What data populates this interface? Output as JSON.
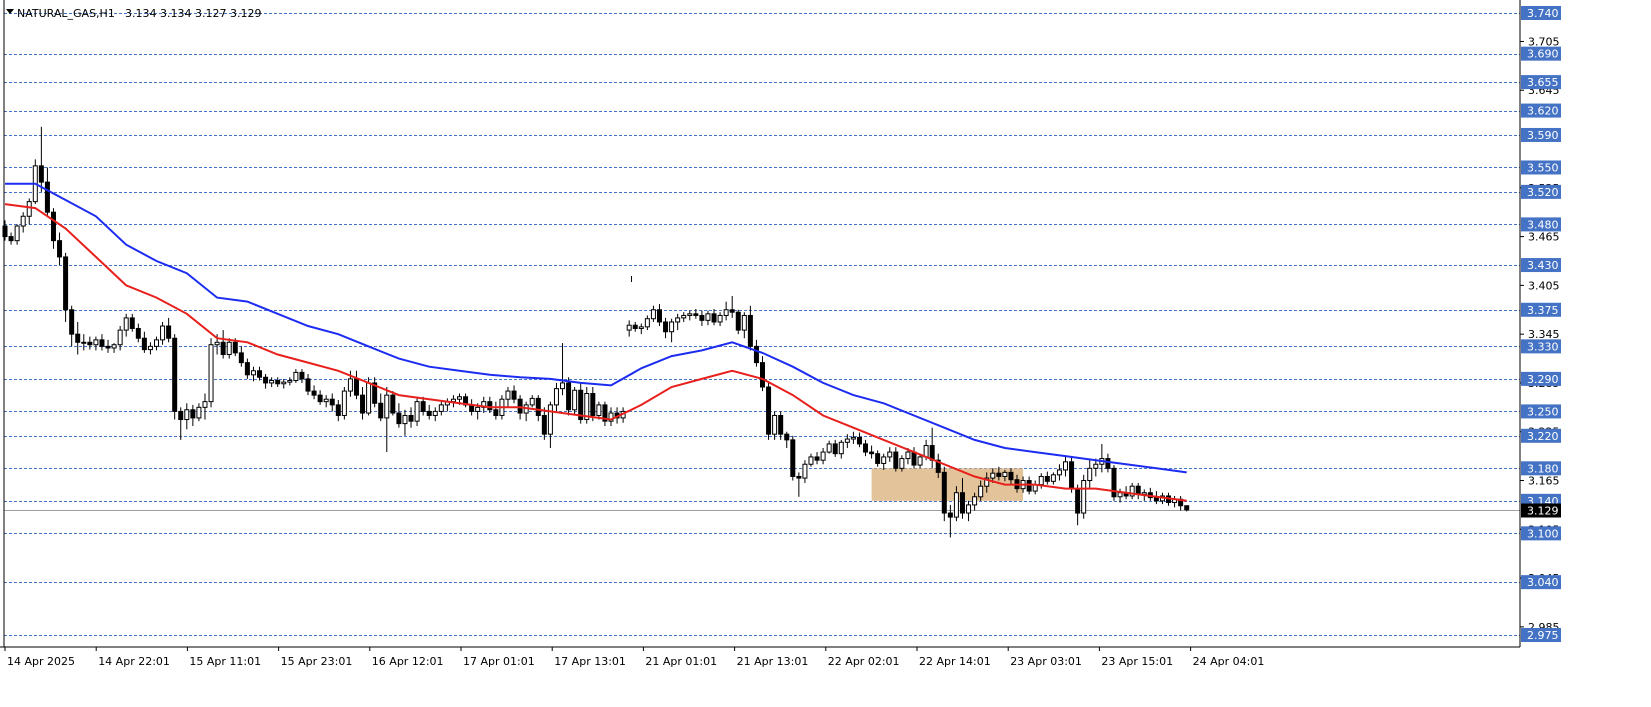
{
  "header": {
    "symbol": "NATURAL_GAS,H1",
    "ohlc": "3.134 3.134 3.127 3.129"
  },
  "colors": {
    "level_line": "#4472c4",
    "level_tag": "#4472c4",
    "ema_fast": "#e8201c",
    "ema_slow": "#1c2cf0",
    "zone": "#deb887",
    "price_tag": "#000000"
  },
  "chart_data": {
    "type": "candlestick",
    "ylim": [
      2.965,
      3.745
    ],
    "y_ticks": [
      "3.705",
      "3.645",
      "3.525",
      "3.465",
      "3.405",
      "3.345",
      "3.285",
      "3.225",
      "3.165",
      "3.105",
      "3.045",
      "2.985"
    ],
    "x_labels": [
      "14 Apr 2025",
      "14 Apr 22:01",
      "15 Apr 11:01",
      "15 Apr 23:01",
      "16 Apr 12:01",
      "17 Apr 01:01",
      "17 Apr 13:01",
      "21 Apr 01:01",
      "21 Apr 13:01",
      "22 Apr 02:01",
      "22 Apr 14:01",
      "23 Apr 03:01",
      "23 Apr 15:01",
      "24 Apr 04:01"
    ],
    "levels": [
      "3.740",
      "3.690",
      "3.655",
      "3.620",
      "3.590",
      "3.550",
      "3.520",
      "3.480",
      "3.430",
      "3.375",
      "3.330",
      "3.290",
      "3.250",
      "3.220",
      "3.180",
      "3.140",
      "3.100",
      "3.040",
      "2.975"
    ],
    "current_price": "3.129",
    "zone": {
      "bar_from": 143,
      "bar_to": 168,
      "price_top": 3.18,
      "price_bottom": 3.14
    },
    "ema_fast": [
      [
        0,
        3.505
      ],
      [
        5,
        3.5
      ],
      [
        10,
        3.475
      ],
      [
        15,
        3.44
      ],
      [
        20,
        3.405
      ],
      [
        25,
        3.39
      ],
      [
        30,
        3.37
      ],
      [
        35,
        3.34
      ],
      [
        40,
        3.335
      ],
      [
        45,
        3.32
      ],
      [
        50,
        3.31
      ],
      [
        55,
        3.3
      ],
      [
        60,
        3.285
      ],
      [
        65,
        3.27
      ],
      [
        70,
        3.265
      ],
      [
        75,
        3.26
      ],
      [
        80,
        3.255
      ],
      [
        85,
        3.255
      ],
      [
        90,
        3.25
      ],
      [
        95,
        3.245
      ],
      [
        100,
        3.24
      ],
      [
        105,
        3.258
      ],
      [
        110,
        3.28
      ],
      [
        115,
        3.29
      ],
      [
        120,
        3.3
      ],
      [
        125,
        3.29
      ],
      [
        130,
        3.27
      ],
      [
        135,
        3.245
      ],
      [
        140,
        3.23
      ],
      [
        145,
        3.215
      ],
      [
        150,
        3.2
      ],
      [
        155,
        3.185
      ],
      [
        160,
        3.17
      ],
      [
        165,
        3.16
      ],
      [
        170,
        3.16
      ],
      [
        175,
        3.155
      ],
      [
        180,
        3.155
      ],
      [
        185,
        3.15
      ],
      [
        190,
        3.145
      ],
      [
        195,
        3.14
      ]
    ],
    "ema_slow": [
      [
        0,
        3.53
      ],
      [
        5,
        3.53
      ],
      [
        10,
        3.51
      ],
      [
        15,
        3.49
      ],
      [
        20,
        3.455
      ],
      [
        25,
        3.435
      ],
      [
        30,
        3.42
      ],
      [
        35,
        3.39
      ],
      [
        40,
        3.385
      ],
      [
        45,
        3.37
      ],
      [
        50,
        3.355
      ],
      [
        55,
        3.345
      ],
      [
        60,
        3.33
      ],
      [
        65,
        3.315
      ],
      [
        70,
        3.305
      ],
      [
        75,
        3.3
      ],
      [
        80,
        3.295
      ],
      [
        85,
        3.292
      ],
      [
        90,
        3.29
      ],
      [
        95,
        3.285
      ],
      [
        100,
        3.282
      ],
      [
        105,
        3.303
      ],
      [
        110,
        3.318
      ],
      [
        115,
        3.325
      ],
      [
        120,
        3.335
      ],
      [
        125,
        3.322
      ],
      [
        130,
        3.305
      ],
      [
        135,
        3.285
      ],
      [
        140,
        3.27
      ],
      [
        145,
        3.26
      ],
      [
        150,
        3.245
      ],
      [
        155,
        3.23
      ],
      [
        160,
        3.215
      ],
      [
        165,
        3.205
      ],
      [
        170,
        3.2
      ],
      [
        175,
        3.195
      ],
      [
        180,
        3.19
      ],
      [
        185,
        3.185
      ],
      [
        190,
        3.18
      ],
      [
        195,
        3.175
      ]
    ],
    "candles": [
      [
        3.478,
        3.485,
        3.46,
        3.465
      ],
      [
        3.465,
        3.47,
        3.455,
        3.46
      ],
      [
        3.46,
        3.48,
        3.455,
        3.478
      ],
      [
        3.478,
        3.495,
        3.47,
        3.49
      ],
      [
        3.49,
        3.512,
        3.48,
        3.508
      ],
      [
        3.508,
        3.56,
        3.505,
        3.552
      ],
      [
        3.552,
        3.6,
        3.52,
        3.532
      ],
      [
        3.532,
        3.55,
        3.49,
        3.495
      ],
      [
        3.495,
        3.5,
        3.45,
        3.46
      ],
      [
        3.46,
        3.47,
        3.43,
        3.44
      ],
      [
        3.44,
        3.445,
        3.36,
        3.375
      ],
      [
        3.375,
        3.38,
        3.33,
        3.345
      ],
      [
        3.345,
        3.36,
        3.32,
        3.335
      ],
      [
        3.335,
        3.345,
        3.325,
        3.335
      ],
      [
        3.335,
        3.342,
        3.326,
        3.332
      ],
      [
        3.332,
        3.342,
        3.325,
        3.338
      ],
      [
        3.338,
        3.345,
        3.325,
        3.33
      ],
      [
        3.33,
        3.338,
        3.322,
        3.328
      ],
      [
        3.328,
        3.334,
        3.322,
        3.332
      ],
      [
        3.332,
        3.355,
        3.325,
        3.35
      ],
      [
        3.35,
        3.37,
        3.342,
        3.365
      ],
      [
        3.365,
        3.37,
        3.348,
        3.352
      ],
      [
        3.352,
        3.358,
        3.335,
        3.34
      ],
      [
        3.34,
        3.348,
        3.322,
        3.326
      ],
      [
        3.326,
        3.335,
        3.32,
        3.33
      ],
      [
        3.33,
        3.342,
        3.325,
        3.338
      ],
      [
        3.338,
        3.36,
        3.332,
        3.355
      ],
      [
        3.355,
        3.365,
        3.335,
        3.34
      ],
      [
        3.34,
        3.345,
        3.24,
        3.25
      ],
      [
        3.25,
        3.255,
        3.215,
        3.24
      ],
      [
        3.24,
        3.26,
        3.228,
        3.252
      ],
      [
        3.252,
        3.258,
        3.232,
        3.242
      ],
      [
        3.242,
        3.26,
        3.238,
        3.255
      ],
      [
        3.255,
        3.272,
        3.24,
        3.262
      ],
      [
        3.262,
        3.34,
        3.255,
        3.332
      ],
      [
        3.332,
        3.345,
        3.32,
        3.335
      ],
      [
        3.335,
        3.35,
        3.315,
        3.32
      ],
      [
        3.32,
        3.34,
        3.315,
        3.335
      ],
      [
        3.335,
        3.34,
        3.318,
        3.322
      ],
      [
        3.322,
        3.33,
        3.305,
        3.31
      ],
      [
        3.31,
        3.315,
        3.29,
        3.295
      ],
      [
        3.295,
        3.305,
        3.287,
        3.3
      ],
      [
        3.3,
        3.305,
        3.288,
        3.292
      ],
      [
        3.292,
        3.296,
        3.278,
        3.285
      ],
      [
        3.285,
        3.292,
        3.28,
        3.288
      ],
      [
        3.288,
        3.292,
        3.28,
        3.284
      ],
      [
        3.284,
        3.29,
        3.278,
        3.286
      ],
      [
        3.286,
        3.292,
        3.282,
        3.288
      ],
      [
        3.288,
        3.302,
        3.285,
        3.298
      ],
      [
        3.298,
        3.302,
        3.285,
        3.29
      ],
      [
        3.29,
        3.296,
        3.27,
        3.275
      ],
      [
        3.275,
        3.282,
        3.265,
        3.27
      ],
      [
        3.27,
        3.276,
        3.258,
        3.262
      ],
      [
        3.262,
        3.27,
        3.255,
        3.265
      ],
      [
        3.265,
        3.272,
        3.25,
        3.258
      ],
      [
        3.258,
        3.264,
        3.238,
        3.245
      ],
      [
        3.245,
        3.28,
        3.24,
        3.275
      ],
      [
        3.275,
        3.3,
        3.268,
        3.29
      ],
      [
        3.29,
        3.3,
        3.265,
        3.27
      ],
      [
        3.27,
        3.28,
        3.24,
        3.248
      ],
      [
        3.248,
        3.292,
        3.245,
        3.285
      ],
      [
        3.285,
        3.292,
        3.255,
        3.26
      ],
      [
        3.26,
        3.272,
        3.238,
        3.242
      ],
      [
        3.242,
        3.28,
        3.2,
        3.27
      ],
      [
        3.27,
        3.275,
        3.245,
        3.248
      ],
      [
        3.248,
        3.26,
        3.23,
        3.235
      ],
      [
        3.235,
        3.252,
        3.22,
        3.245
      ],
      [
        3.245,
        3.255,
        3.23,
        3.238
      ],
      [
        3.238,
        3.268,
        3.232,
        3.262
      ],
      [
        3.262,
        3.268,
        3.245,
        3.25
      ],
      [
        3.25,
        3.258,
        3.24,
        3.245
      ],
      [
        3.245,
        3.255,
        3.238,
        3.25
      ],
      [
        3.25,
        3.262,
        3.245,
        3.258
      ],
      [
        3.258,
        3.266,
        3.25,
        3.262
      ],
      [
        3.262,
        3.27,
        3.255,
        3.265
      ],
      [
        3.265,
        3.272,
        3.258,
        3.268
      ],
      [
        3.268,
        3.272,
        3.255,
        3.258
      ],
      [
        3.258,
        3.265,
        3.245,
        3.25
      ],
      [
        3.25,
        3.26,
        3.24,
        3.255
      ],
      [
        3.255,
        3.268,
        3.248,
        3.262
      ],
      [
        3.262,
        3.268,
        3.248,
        3.252
      ],
      [
        3.252,
        3.262,
        3.24,
        3.245
      ],
      [
        3.245,
        3.27,
        3.24,
        3.265
      ],
      [
        3.265,
        3.28,
        3.255,
        3.275
      ],
      [
        3.275,
        3.282,
        3.26,
        3.265
      ],
      [
        3.265,
        3.27,
        3.24,
        3.248
      ],
      [
        3.248,
        3.262,
        3.238,
        3.258
      ],
      [
        3.258,
        3.27,
        3.255,
        3.266
      ],
      [
        3.266,
        3.27,
        3.238,
        3.245
      ],
      [
        3.245,
        3.255,
        3.215,
        3.222
      ],
      [
        3.222,
        3.262,
        3.205,
        3.258
      ],
      [
        3.258,
        3.285,
        3.25,
        3.278
      ],
      [
        3.278,
        3.334,
        3.27,
        3.285
      ],
      [
        3.285,
        3.292,
        3.245,
        3.252
      ],
      [
        3.252,
        3.28,
        3.245,
        3.276
      ],
      [
        3.276,
        3.285,
        3.235,
        3.24
      ],
      [
        3.24,
        3.28,
        3.235,
        3.272
      ],
      [
        3.272,
        3.28,
        3.238,
        3.245
      ],
      [
        3.245,
        3.262,
        3.24,
        3.258
      ],
      [
        3.258,
        3.262,
        3.232,
        3.238
      ],
      [
        3.238,
        3.255,
        3.232,
        3.248
      ],
      [
        3.248,
        3.255,
        3.235,
        3.242
      ],
      [
        3.242,
        3.255,
        3.236,
        3.25
      ],
      [
        3.35,
        3.362,
        3.342,
        3.356
      ],
      [
        3.356,
        3.36,
        3.348,
        3.352
      ],
      [
        3.352,
        3.358,
        3.345,
        3.354
      ],
      [
        3.354,
        3.368,
        3.35,
        3.364
      ],
      [
        3.364,
        3.38,
        3.36,
        3.375
      ],
      [
        3.375,
        3.382,
        3.355,
        3.36
      ],
      [
        3.36,
        3.365,
        3.34,
        3.348
      ],
      [
        3.348,
        3.364,
        3.335,
        3.36
      ],
      [
        3.36,
        3.37,
        3.35,
        3.365
      ],
      [
        3.365,
        3.372,
        3.36,
        3.368
      ],
      [
        3.368,
        3.374,
        3.362,
        3.37
      ],
      [
        3.37,
        3.376,
        3.364,
        3.368
      ],
      [
        3.368,
        3.374,
        3.355,
        3.362
      ],
      [
        3.362,
        3.374,
        3.356,
        3.37
      ],
      [
        3.37,
        3.376,
        3.356,
        3.36
      ],
      [
        3.36,
        3.372,
        3.355,
        3.368
      ],
      [
        3.368,
        3.385,
        3.362,
        3.375
      ],
      [
        3.375,
        3.392,
        3.365,
        3.372
      ],
      [
        3.372,
        3.375,
        3.345,
        3.35
      ],
      [
        3.35,
        3.372,
        3.34,
        3.368
      ],
      [
        3.368,
        3.38,
        3.325,
        3.33
      ],
      [
        3.33,
        3.338,
        3.305,
        3.31
      ],
      [
        3.31,
        3.318,
        3.275,
        3.28
      ],
      [
        3.28,
        3.285,
        3.215,
        3.222
      ],
      [
        3.222,
        3.25,
        3.215,
        3.245
      ],
      [
        3.245,
        3.25,
        3.215,
        3.222
      ],
      [
        3.222,
        3.225,
        3.205,
        3.215
      ],
      [
        3.215,
        3.22,
        3.165,
        3.17
      ],
      [
        3.17,
        3.175,
        3.145,
        3.168
      ],
      [
        3.168,
        3.19,
        3.162,
        3.185
      ],
      [
        3.185,
        3.198,
        3.182,
        3.194
      ],
      [
        3.194,
        3.2,
        3.185,
        3.19
      ],
      [
        3.19,
        3.205,
        3.185,
        3.2
      ],
      [
        3.2,
        3.214,
        3.198,
        3.21
      ],
      [
        3.21,
        3.215,
        3.194,
        3.198
      ],
      [
        3.198,
        3.215,
        3.192,
        3.212
      ],
      [
        3.212,
        3.222,
        3.205,
        3.216
      ],
      [
        3.216,
        3.225,
        3.21,
        3.218
      ],
      [
        3.218,
        3.224,
        3.206,
        3.21
      ],
      [
        3.21,
        3.215,
        3.195,
        3.2
      ],
      [
        3.2,
        3.208,
        3.192,
        3.198
      ],
      [
        3.198,
        3.202,
        3.182,
        3.186
      ],
      [
        3.186,
        3.198,
        3.178,
        3.194
      ],
      [
        3.194,
        3.206,
        3.188,
        3.2
      ],
      [
        3.2,
        3.206,
        3.176,
        3.18
      ],
      [
        3.18,
        3.196,
        3.176,
        3.192
      ],
      [
        3.192,
        3.205,
        3.185,
        3.2
      ],
      [
        3.2,
        3.206,
        3.18,
        3.184
      ],
      [
        3.184,
        3.198,
        3.18,
        3.194
      ],
      [
        3.194,
        3.215,
        3.19,
        3.208
      ],
      [
        3.208,
        3.23,
        3.18,
        3.19
      ],
      [
        3.19,
        3.198,
        3.168,
        3.175
      ],
      [
        3.175,
        3.182,
        3.115,
        3.125
      ],
      [
        3.125,
        3.135,
        3.095,
        3.12
      ],
      [
        3.12,
        3.158,
        3.115,
        3.15
      ],
      [
        3.15,
        3.168,
        3.118,
        3.125
      ],
      [
        3.125,
        3.14,
        3.115,
        3.135
      ],
      [
        3.135,
        3.15,
        3.128,
        3.145
      ],
      [
        3.145,
        3.165,
        3.14,
        3.158
      ],
      [
        3.158,
        3.175,
        3.15,
        3.168
      ],
      [
        3.168,
        3.18,
        3.162,
        3.174
      ],
      [
        3.174,
        3.182,
        3.165,
        3.17
      ],
      [
        3.17,
        3.178,
        3.164,
        3.175
      ],
      [
        3.175,
        3.18,
        3.16,
        3.166
      ],
      [
        3.166,
        3.172,
        3.15,
        3.155
      ],
      [
        3.155,
        3.17,
        3.15,
        3.165
      ],
      [
        3.165,
        3.17,
        3.148,
        3.152
      ],
      [
        3.152,
        3.165,
        3.148,
        3.16
      ],
      [
        3.16,
        3.174,
        3.155,
        3.17
      ],
      [
        3.17,
        3.176,
        3.16,
        3.164
      ],
      [
        3.164,
        3.175,
        3.16,
        3.172
      ],
      [
        3.172,
        3.185,
        3.165,
        3.178
      ],
      [
        3.178,
        3.195,
        3.17,
        3.188
      ],
      [
        3.188,
        3.195,
        3.15,
        3.155
      ],
      [
        3.155,
        3.16,
        3.11,
        3.125
      ],
      [
        3.125,
        3.172,
        3.118,
        3.165
      ],
      [
        3.165,
        3.19,
        3.155,
        3.18
      ],
      [
        3.18,
        3.192,
        3.17,
        3.185
      ],
      [
        3.185,
        3.21,
        3.175,
        3.192
      ],
      [
        3.192,
        3.198,
        3.175,
        3.18
      ],
      [
        3.18,
        3.184,
        3.14,
        3.145
      ],
      [
        3.145,
        3.155,
        3.138,
        3.15
      ],
      [
        3.15,
        3.158,
        3.142,
        3.146
      ],
      [
        3.146,
        3.162,
        3.142,
        3.158
      ],
      [
        3.158,
        3.162,
        3.142,
        3.148
      ],
      [
        3.148,
        3.154,
        3.14,
        3.15
      ],
      [
        3.15,
        3.156,
        3.14,
        3.144
      ],
      [
        3.144,
        3.152,
        3.136,
        3.14
      ],
      [
        3.14,
        3.15,
        3.136,
        3.146
      ],
      [
        3.146,
        3.15,
        3.134,
        3.138
      ],
      [
        3.138,
        3.146,
        3.132,
        3.142
      ],
      [
        3.142,
        3.146,
        3.128,
        3.134
      ],
      [
        3.134,
        3.134,
        3.127,
        3.129
      ]
    ]
  }
}
